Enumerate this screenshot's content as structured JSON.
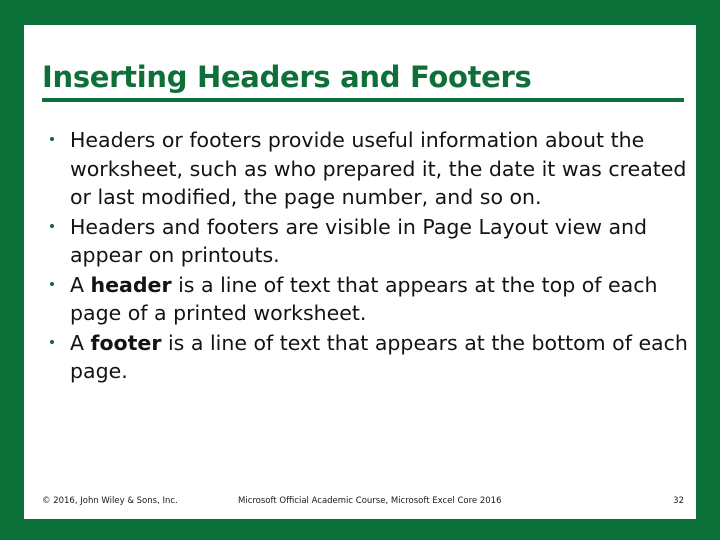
{
  "slide": {
    "title": "Inserting Headers and Footers",
    "accent_color": "#0a7038",
    "title_color": "#0e7038",
    "bullet_color": "#1d5c38",
    "body_color": "#131313",
    "bullets": [
      {
        "segments": [
          {
            "text": "Headers or footers provide useful information about the worksheet, such as who prepared it, the date it was created or last modified, the page number, and so on.",
            "bold": false
          }
        ]
      },
      {
        "segments": [
          {
            "text": "Headers and footers are visible in Page Layout view and appear on printouts.",
            "bold": false
          }
        ]
      },
      {
        "segments": [
          {
            "text": "A ",
            "bold": false
          },
          {
            "text": "header",
            "bold": true
          },
          {
            "text": " is a line of text that appears at the top of each page of a printed worksheet.",
            "bold": false
          }
        ]
      },
      {
        "segments": [
          {
            "text": "A ",
            "bold": false
          },
          {
            "text": "footer",
            "bold": true
          },
          {
            "text": " is a line of text that appears at the bottom of each page.",
            "bold": false
          }
        ]
      }
    ],
    "footer": {
      "copyright": "© 2016, John Wiley & Sons, Inc.",
      "course": "Microsoft Official Academic Course, Microsoft Excel Core 2016",
      "page_number": "32"
    }
  }
}
